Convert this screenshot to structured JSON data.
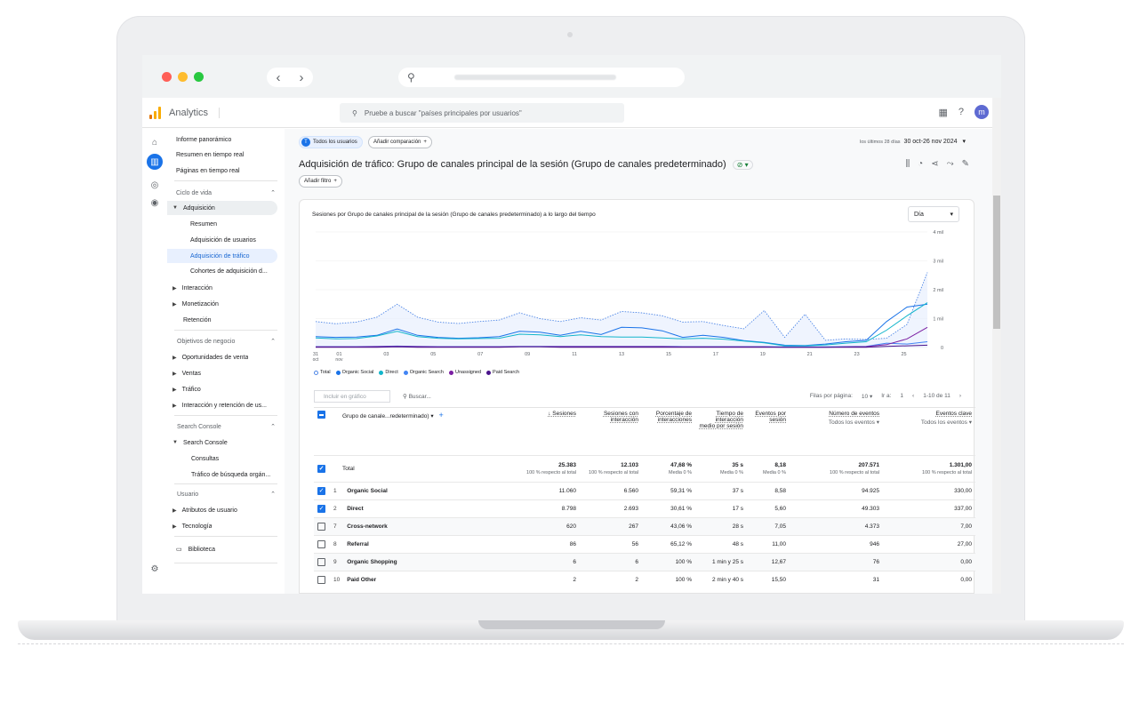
{
  "app": {
    "name": "Analytics",
    "search_placeholder": "Pruebe a buscar \"países principales por usuarios\"",
    "avatar_letter": "m",
    "accent": "#1a73e8"
  },
  "sidebar": {
    "items": [
      {
        "label": "Informe panorámico",
        "indent": 0
      },
      {
        "label": "Resumen en tiempo real",
        "indent": 0
      },
      {
        "label": "Páginas en tiempo real",
        "indent": 0
      }
    ],
    "lifecycle": {
      "section": "Ciclo de vida",
      "acquisition": "Adquisición",
      "acquisition_items": [
        "Resumen",
        "Adquisición de usuarios",
        "Adquisición de tráfico",
        "Cohortes de adquisición d..."
      ],
      "other": [
        "Interacción",
        "Monetización",
        "Retención"
      ]
    },
    "business": {
      "section": "Objetivos de negocio",
      "items": [
        "Oportunidades de venta",
        "Ventas",
        "Tráfico",
        "Interacción y retención de us..."
      ]
    },
    "search_console": {
      "section": "Search Console",
      "parent": "Search Console",
      "items": [
        "Consultas",
        "Tráfico de búsqueda orgán..."
      ]
    },
    "user": {
      "section": "Usuario",
      "items": [
        "Atributos de usuario",
        "Tecnología"
      ]
    },
    "library": "Biblioteca"
  },
  "header": {
    "chip_all_users": "Todos los usuarios",
    "chip_all_users_letter": "T",
    "chip_add_comparison": "Añadir comparación",
    "date_prefix": "los últimos 28 días",
    "date_range": "30 oct-26 nov 2024",
    "title": "Adquisición de tráfico: Grupo de canales principal de la sesión (Grupo de canales predeterminado)",
    "add_filter": "Añadir filtro"
  },
  "chart": {
    "heading": "Sesiones por Grupo de canales principal de la sesión (Grupo de canales predeterminado) a lo largo del tiempo",
    "granularity": "Día"
  },
  "chart_data": {
    "type": "line",
    "x": [
      "31 oct",
      "01 nov",
      "02",
      "03",
      "04",
      "05",
      "06",
      "07",
      "08",
      "09",
      "10",
      "11",
      "12",
      "13",
      "14",
      "15",
      "16",
      "17",
      "18",
      "19",
      "20",
      "21",
      "22",
      "23",
      "24",
      "25",
      "26"
    ],
    "x_tick_labels": [
      "31",
      "01",
      "03",
      "05",
      "07",
      "09",
      "11",
      "13",
      "15",
      "17",
      "19",
      "21",
      "23",
      "25"
    ],
    "x_tick_sublabels": {
      "31": "oct",
      "01": "nov"
    },
    "y_ticks": [
      "0",
      "1 mil",
      "2 mil",
      "3 mil",
      "4 mil"
    ],
    "ylim": [
      0,
      4000
    ],
    "legend_position": "bottom-left",
    "series": [
      {
        "name": "Total",
        "color": "#4e86e6",
        "dashed": true,
        "area": true,
        "values": [
          900,
          820,
          880,
          1050,
          1500,
          1050,
          880,
          830,
          900,
          950,
          1200,
          1000,
          900,
          1030,
          950,
          1250,
          1200,
          1100,
          880,
          900,
          760,
          650,
          1280,
          350,
          1150,
          250,
          300,
          280,
          320,
          800,
          2600
        ]
      },
      {
        "name": "Organic Social",
        "color": "#1a73e8",
        "values": [
          380,
          350,
          360,
          420,
          640,
          420,
          350,
          320,
          340,
          380,
          560,
          530,
          420,
          560,
          450,
          700,
          680,
          580,
          350,
          420,
          350,
          240,
          180,
          80,
          70,
          120,
          200,
          250,
          900,
          1400,
          1500
        ]
      },
      {
        "name": "Direct",
        "color": "#12b5cb",
        "values": [
          330,
          300,
          310,
          400,
          560,
          380,
          320,
          300,
          310,
          320,
          460,
          440,
          380,
          440,
          380,
          360,
          360,
          330,
          300,
          320,
          290,
          220,
          160,
          60,
          60,
          90,
          150,
          200,
          600,
          1100,
          1550
        ]
      },
      {
        "name": "Organic Search",
        "color": "#4285f4",
        "values": [
          30,
          30,
          30,
          40,
          50,
          40,
          30,
          30,
          30,
          30,
          40,
          40,
          40,
          40,
          40,
          40,
          40,
          40,
          30,
          30,
          30,
          30,
          30,
          20,
          20,
          20,
          30,
          40,
          150,
          120,
          200
        ]
      },
      {
        "name": "Unassigned",
        "color": "#7b1fa2",
        "values": [
          20,
          20,
          20,
          30,
          40,
          30,
          20,
          20,
          20,
          20,
          30,
          30,
          30,
          30,
          30,
          30,
          30,
          30,
          20,
          20,
          20,
          20,
          20,
          10,
          10,
          10,
          20,
          30,
          100,
          300,
          700
        ]
      },
      {
        "name": "Paid Search",
        "color": "#4a148c",
        "values": [
          10,
          10,
          10,
          10,
          20,
          10,
          10,
          10,
          10,
          10,
          20,
          20,
          10,
          10,
          10,
          10,
          10,
          10,
          10,
          10,
          10,
          10,
          10,
          10,
          10,
          10,
          10,
          10,
          40,
          60,
          80
        ]
      }
    ]
  },
  "table": {
    "include_chart": "Incluir en gráfico",
    "search": "Buscar...",
    "rows_per_page_label": "Filas por página:",
    "rows_per_page": "10",
    "go_to_label": "Ir a:",
    "go_to": "1",
    "range": "1-10 de 11",
    "dimension_header": "Grupo de canale...redeterminado)",
    "columns": [
      {
        "label": "↓ Sesiones",
        "sub": ""
      },
      {
        "label": "Sesiones con interacción",
        "sub": ""
      },
      {
        "label": "Porcentaje de interacciones",
        "sub": ""
      },
      {
        "label": "Tiempo de interacción medio por sesión",
        "sub": ""
      },
      {
        "label": "Eventos por sesión",
        "sub": ""
      },
      {
        "label": "Número de eventos",
        "sub": "Todos los eventos ▾"
      },
      {
        "label": "Eventos clave",
        "sub": "Todos los eventos ▾"
      }
    ],
    "total": {
      "label": "Total",
      "values": [
        "25.383",
        "12.103",
        "47,68 %",
        "35 s",
        "8,18",
        "207.571",
        "1.301,00"
      ],
      "subs": [
        "100 % respecto al total",
        "100 % respecto al total",
        "Media 0 %",
        "Media 0 %",
        "Media 0 %",
        "100 % respecto al total",
        "100 % respecto al total"
      ]
    },
    "rows": [
      {
        "idx": "1",
        "name": "Organic Social",
        "checked": true,
        "values": [
          "11.060",
          "6.560",
          "59,31 %",
          "37 s",
          "8,58",
          "94.925",
          "330,00"
        ]
      },
      {
        "idx": "2",
        "name": "Direct",
        "checked": true,
        "values": [
          "8.798",
          "2.693",
          "30,61 %",
          "17 s",
          "5,60",
          "49.303",
          "337,00"
        ]
      },
      {
        "idx": "7",
        "name": "Cross-network",
        "checked": false,
        "values": [
          "620",
          "267",
          "43,06 %",
          "28 s",
          "7,05",
          "4.373",
          "7,00"
        ]
      },
      {
        "idx": "8",
        "name": "Referral",
        "checked": false,
        "values": [
          "86",
          "56",
          "65,12 %",
          "48 s",
          "11,00",
          "946",
          "27,00"
        ]
      },
      {
        "idx": "9",
        "name": "Organic Shopping",
        "checked": false,
        "values": [
          "6",
          "6",
          "100 %",
          "1 min y 25 s",
          "12,67",
          "76",
          "0,00"
        ]
      },
      {
        "idx": "10",
        "name": "Paid Other",
        "checked": false,
        "values": [
          "2",
          "2",
          "100 %",
          "2 min y 40 s",
          "15,50",
          "31",
          "0,00"
        ]
      }
    ]
  }
}
